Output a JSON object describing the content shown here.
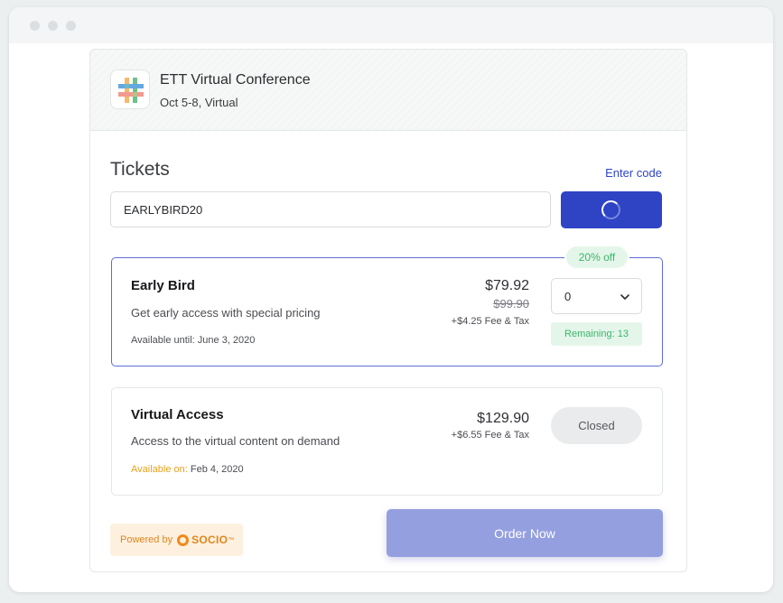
{
  "event": {
    "title": "ETT Virtual Conference",
    "subtitle": "Oct 5-8, Virtual",
    "logo_icon": "hashtag-logo-icon"
  },
  "tickets": {
    "heading": "Tickets",
    "enter_code_label": "Enter code",
    "promo_value": "EARLYBIRD20",
    "apply_button_state": "loading"
  },
  "items": [
    {
      "name": "Early Bird",
      "description": "Get early access with special pricing",
      "availability": "Available until: June 3, 2020",
      "price": "$79.92",
      "original_price": "$99.90",
      "fee": "+$4.25 Fee & Tax",
      "badge": "20% off",
      "quantity": "0",
      "remaining": "Remaining: 13"
    },
    {
      "name": "Virtual Access",
      "description": "Access to the virtual content on demand",
      "availability_label": "Available on:",
      "availability_date": " Feb 4, 2020",
      "price": "$129.90",
      "fee": "+$6.55 Fee & Tax",
      "status": "Closed"
    }
  ],
  "footer": {
    "powered_by": "Powered by",
    "brand": "SOCIO",
    "trademark": "™",
    "order_button": "Order Now"
  },
  "colors": {
    "accent": "#2e44c5",
    "order_disabled": "#949fdf",
    "success": "#3cb56b",
    "warning": "#e8a21c"
  }
}
